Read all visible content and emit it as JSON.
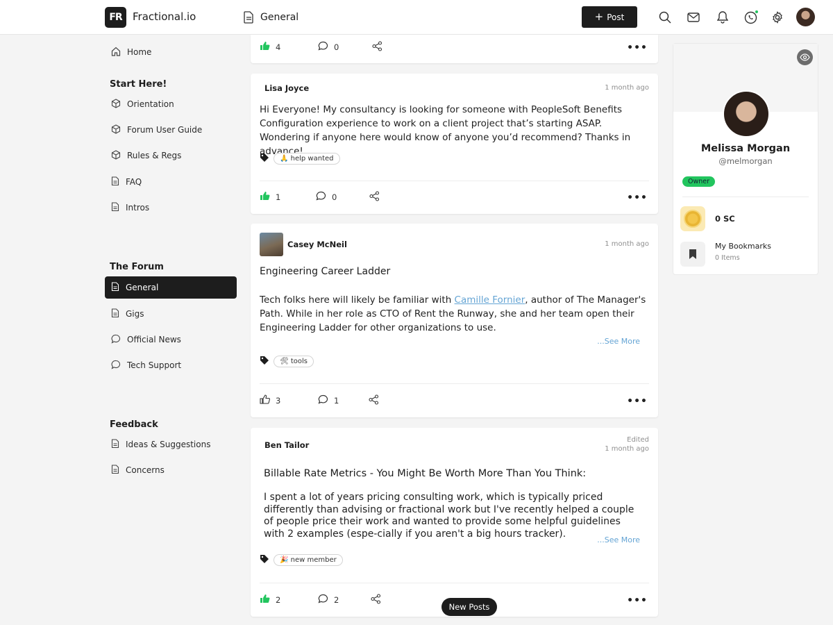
{
  "app": {
    "logo_mark": "FR",
    "name": "Fractional.io",
    "breadcrumb": "General",
    "post_button": "Post"
  },
  "sidebar": {
    "home": "Home",
    "sections": [
      {
        "title": "Start Here!",
        "items": [
          "Orientation",
          "Forum User Guide",
          "Rules & Regs",
          "FAQ",
          "Intros"
        ]
      },
      {
        "title": "The Forum",
        "items": [
          "General",
          "Gigs",
          "Official News",
          "Tech Support"
        ]
      },
      {
        "title": "Feedback",
        "items": [
          "Ideas & Suggestions",
          "Concerns"
        ]
      }
    ],
    "active_item": "General"
  },
  "posts": [
    {
      "likes": "4",
      "comments": "0"
    },
    {
      "author": "Lisa Joyce",
      "time": "1 month ago",
      "body": "Hi Everyone! My consultancy is looking for someone with PeopleSoft Benefits Configuration experience to work on a client project that’s starting ASAP. Wondering if anyone here would know of anyone you’d recommend? Thanks in advance!",
      "tag": "🙏 help wanted",
      "likes": "1",
      "comments": "0"
    },
    {
      "author": "Casey McNeil",
      "time": "1 month ago",
      "title": "Engineering Career Ladder",
      "body_pre": "Tech folks here will likely be familiar with ",
      "body_link": "Camille Fornier",
      "body_post": ", author of The Manager's Path. While in her role as CTO of Rent the Runway, she and her team open their Engineering Ladder for other organizations to use.",
      "see_more": "...See More",
      "tag": "🛠 tools",
      "likes": "3",
      "comments": "1"
    },
    {
      "author": "Ben Tailor",
      "edited": "Edited",
      "time": "1 month ago",
      "title": "Billable Rate Metrics - You Might Be Worth More Than You Think:",
      "body": "I spent a lot of years pricing consulting work, which is typically priced differently than advising or fractional work but I've recently helped a couple of people price their work and wanted to provide some helpful guidelines with 2 examples (espe-cially if you aren't a big hours tracker).",
      "see_more": "...See More",
      "tag": "🎉 new member",
      "likes": "2",
      "comments": "2"
    }
  ],
  "profile": {
    "name": "Melissa Morgan",
    "handle": "@melmorgan",
    "role_badge": "Owner",
    "coins": "0 SC",
    "bookmarks_title": "My Bookmarks",
    "bookmarks_count": "0 Items"
  },
  "new_posts_button": "New Posts",
  "colors": {
    "accent_dark": "#1d1d1d",
    "like_green": "#22c55e",
    "link_blue": "#64a4d4",
    "owner_badge": "#22c55e"
  }
}
